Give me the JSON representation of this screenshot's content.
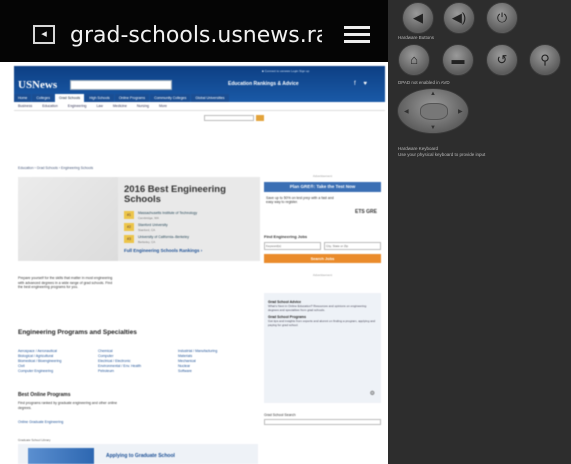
{
  "browser": {
    "url": "grad-schools.usnews.rank",
    "back_icon": "[←]",
    "menu_icon": "hamburger-menu-icon"
  },
  "site": {
    "logo": "USNews",
    "topline": "■ Connect to usnews    Login    Sign up",
    "tagline": "Education Rankings & Advice",
    "social": "f ♥",
    "nav": [
      "Home",
      "Colleges",
      "Grad Schools",
      "High Schools",
      "Online Programs",
      "Community Colleges",
      "Global Universities"
    ],
    "subnav": [
      "Business",
      "Education",
      "Engineering",
      "Law",
      "Medicine",
      "Nursing",
      "More"
    ],
    "breadcrumb": "Education › Grad Schools › Engineering Schools",
    "hero": {
      "title": "2016 Best Engineering Schools",
      "ranks": [
        {
          "badge": "#1",
          "name": "Massachusetts Institute of Technology",
          "loc": "Cambridge, MA"
        },
        {
          "badge": "#2",
          "name": "Stanford University",
          "loc": "Stanford, CA"
        },
        {
          "badge": "#3",
          "name": "University of California--Berkeley",
          "loc": "Berkeley, CA"
        }
      ],
      "link": "Full Engineering Schools Rankings ›"
    },
    "intro": "Prepare yourself for the skills that matter in most engineering with advanced degrees in a wide range of grad schools. Find the best engineering programs for you.",
    "programs_title": "Engineering Programs and Specialties",
    "programs": [
      "Aerospace / Aeronautical",
      "Chemical",
      "Industrial / Manufacturing",
      "Biological / Agricultural",
      "Computer",
      "Materials",
      "Biomedical / Bioengineering",
      "Electrical / Electronic",
      "Mechanical",
      "Civil",
      "Environmental / Env. Health",
      "Nuclear",
      "Computer Engineering",
      "Petroleum",
      "Software"
    ],
    "online_title": "Best Online Programs",
    "online_text": "Find programs ranked by graduate engineering and other online degrees.",
    "online_link": "Online Graduate Engineering",
    "library_label": "Graduate School Library",
    "library_title": "Applying to Graduate School",
    "sidebar": {
      "ad_label": "Advertisement",
      "gre_button": "Plan GRE®: Take the Test Now",
      "gre_text": "Save up to 50% on test prep with a fast and easy way to register.",
      "gre_logo": "ETS GRE",
      "find_title": "Find Engineering Jobs",
      "find_placeholder_1": "Keyword(s)",
      "find_placeholder_2": "City, State or Zip",
      "find_button": "Search Jobs",
      "guide_heading_1": "Grad School Advice",
      "guide_text_1": "What's Next in Online Education? Resources and opinions on engineering degrees and specialties from grad schools.",
      "guide_heading_2": "Grad School Programs",
      "guide_text_2": "Get tips and insights from experts and alumni on finding a program, applying and paying for grad school.",
      "search_label": "Grad School Search"
    }
  },
  "panel": {
    "top_buttons": [
      "volume-down-icon",
      "volume-up-icon",
      "power-icon"
    ],
    "hardware_label": "Hardware Buttons",
    "mid_buttons": [
      "home-icon",
      "menu-icon",
      "back-icon",
      "search-icon"
    ],
    "dpad_label": "DPAD  not enabled in AVD",
    "keyboard_label": "Hardware Keyboard",
    "keyboard_hint": "Use your physical keyboard to provide input"
  }
}
